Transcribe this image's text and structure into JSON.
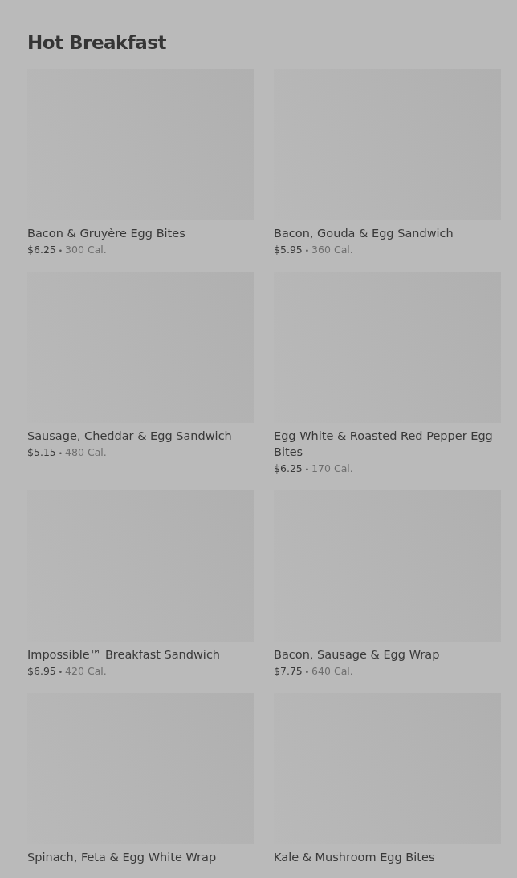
{
  "section": {
    "title": "Hot Breakfast"
  },
  "items": [
    {
      "name": "Bacon & Gruyère Egg Bites",
      "price": "$6.25",
      "calories": "300 Cal."
    },
    {
      "name": "Bacon, Gouda & Egg Sandwich",
      "price": "$5.95",
      "calories": "360 Cal."
    },
    {
      "name": "Sausage, Cheddar & Egg Sandwich",
      "price": "$5.15",
      "calories": "480 Cal."
    },
    {
      "name": "Egg White & Roasted Red Pepper Egg Bites",
      "price": "$6.25",
      "calories": "170 Cal."
    },
    {
      "name": "Impossible™ Breakfast Sandwich",
      "price": "$6.95",
      "calories": "420 Cal."
    },
    {
      "name": "Bacon, Sausage & Egg Wrap",
      "price": "$7.75",
      "calories": "640 Cal."
    },
    {
      "name": "Spinach, Feta & Egg White Wrap"
    },
    {
      "name": "Kale & Mushroom Egg Bites"
    }
  ],
  "separator": "•"
}
